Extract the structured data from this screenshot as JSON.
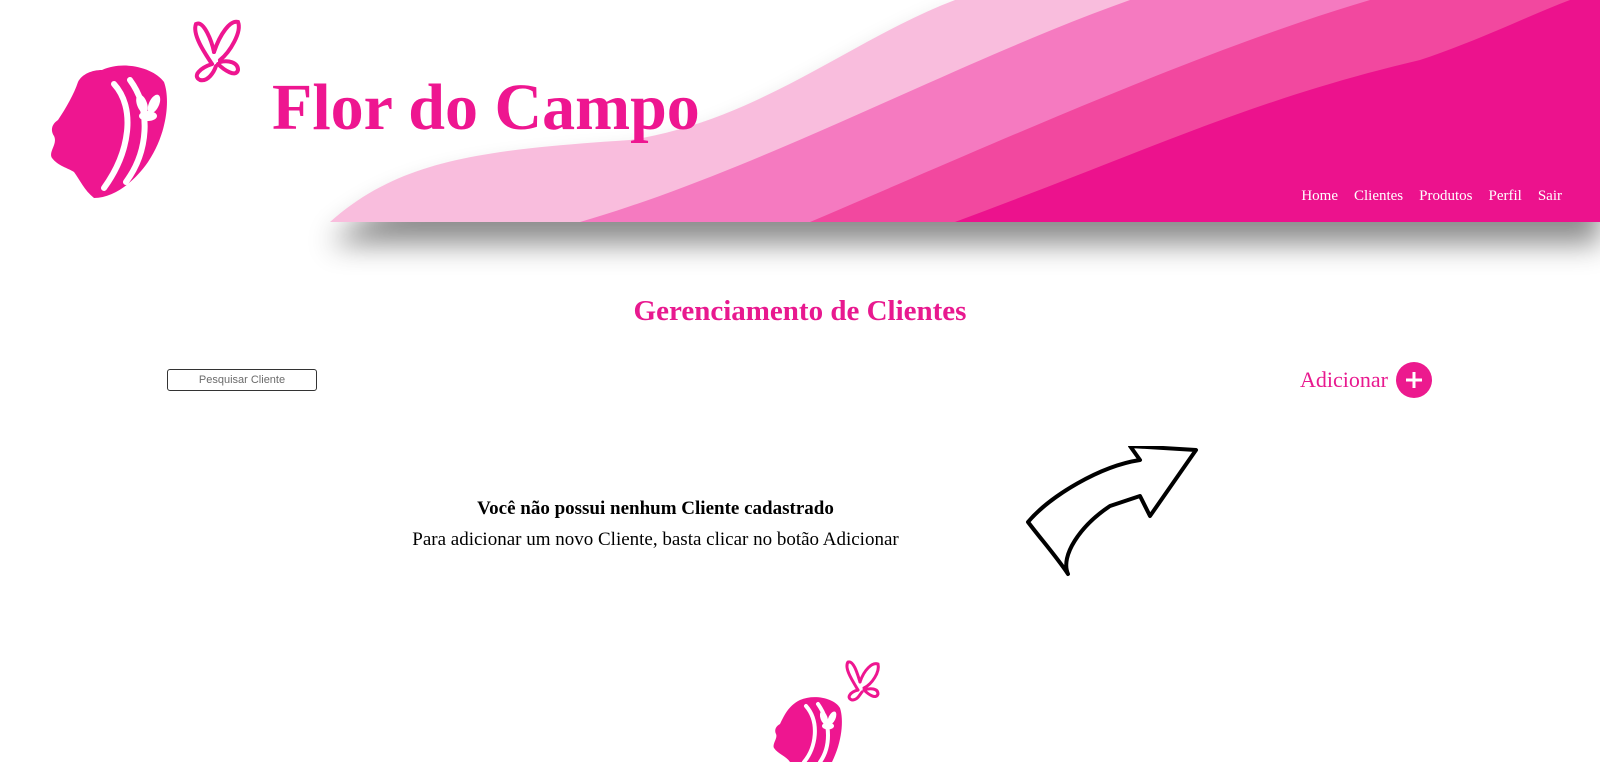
{
  "header": {
    "title": "Flor do Campo",
    "logo_icon": "woman-butterfly-logo-icon",
    "nav": [
      {
        "label": "Home"
      },
      {
        "label": "Clientes"
      },
      {
        "label": "Produtos"
      },
      {
        "label": "Perfil"
      },
      {
        "label": "Sair"
      }
    ]
  },
  "main": {
    "heading": "Gerenciamento de Clientes",
    "search": {
      "placeholder": "Pesquisar Cliente",
      "value": ""
    },
    "add_button": {
      "label": "Adicionar",
      "icon": "plus-icon"
    },
    "empty_state": {
      "title": "Você não possui nenhum Cliente cadastrado",
      "text": "Para adicionar um novo Cliente, basta clicar no botão Adicionar",
      "icon": "arrow-up-right-icon"
    }
  },
  "colors": {
    "brand_pink": "#ee1690",
    "wave_light": "#f9bddd",
    "wave_mid": "#f57ac0",
    "wave_mid_dark": "#f2489f",
    "wave_dark": "#ec128d"
  }
}
